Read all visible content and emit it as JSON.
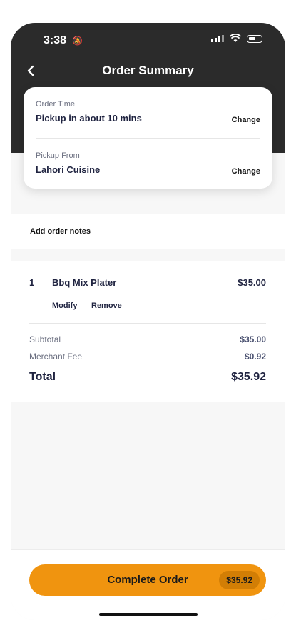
{
  "status_bar": {
    "time": "3:38",
    "bell_icon": "bell-slash-icon"
  },
  "header": {
    "title": "Order Summary",
    "back_icon": "chevron-left-icon"
  },
  "order_time": {
    "label": "Order Time",
    "value": "Pickup in about 10 mins",
    "action": "Change"
  },
  "pickup_from": {
    "label": "Pickup From",
    "value": "Lahori Cuisine",
    "action": "Change"
  },
  "notes": {
    "label": "Add order notes"
  },
  "items": [
    {
      "qty": "1",
      "name": "Bbq Mix Plater",
      "price": "$35.00",
      "modify": "Modify",
      "remove": "Remove"
    }
  ],
  "summary": {
    "subtotal_label": "Subtotal",
    "subtotal": "$35.00",
    "fee_label": "Merchant Fee",
    "fee": "$0.92",
    "total_label": "Total",
    "total": "$35.92"
  },
  "cta": {
    "label": "Complete Order",
    "amount": "$35.92"
  },
  "colors": {
    "accent": "#f0940f",
    "header_bg": "#2b2b2b"
  }
}
